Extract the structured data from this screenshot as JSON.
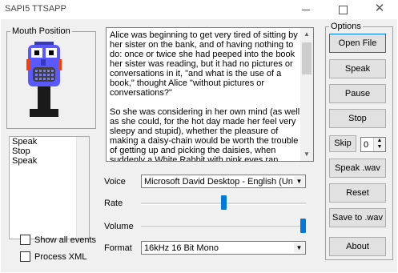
{
  "window": {
    "title": "SAPI5 TTSAPP",
    "controls": {
      "minimize": "minimize",
      "maximize": "maximize",
      "close": "✕"
    }
  },
  "mouth_group": {
    "legend": "Mouth Position",
    "colors": {
      "face": "#5959ff",
      "mouth": "#404040",
      "accent": "#ff3c00"
    }
  },
  "events_list": {
    "items": [
      "Speak",
      "Stop",
      "Speak"
    ]
  },
  "checkboxes": {
    "show_all_events": {
      "label": "Show all events",
      "checked": false
    },
    "process_xml": {
      "label": "Process XML",
      "checked": false
    }
  },
  "text_area": {
    "text": "Alice was beginning to get very tired of sitting by her sister on the bank, and of having nothing to do: once or twice she had peeped into the book her sister was reading, but it had no pictures or conversations in it, \"and what is the use of a book,\" thought Alice \"without pictures or conversations?\"\n\nSo she was considering in her own mind (as well as she could, for the hot day made her feel very sleepy and stupid), whether the pleasure of making a daisy-chain would be worth the trouble of getting up and picking the daisies, when suddenly a White Rabbit with pink eyes ran close by her.\n\nThere was nothing so very remarkable in that; nor did"
  },
  "voice": {
    "label": "Voice",
    "value": "Microsoft David Desktop - English (United St"
  },
  "rate": {
    "label": "Rate",
    "level": 0.5
  },
  "volume": {
    "label": "Volume",
    "level": 1.0
  },
  "format": {
    "label": "Format",
    "value": "16kHz 16 Bit Mono"
  },
  "options_group": {
    "legend": "Options",
    "open_file": "Open File",
    "speak": "Speak",
    "pause": "Pause",
    "stop": "Stop",
    "skip": "Skip",
    "skip_value": "0",
    "speak_wav": "Speak .wav",
    "reset": "Reset",
    "save_wav": "Save to .wav",
    "about": "About"
  }
}
